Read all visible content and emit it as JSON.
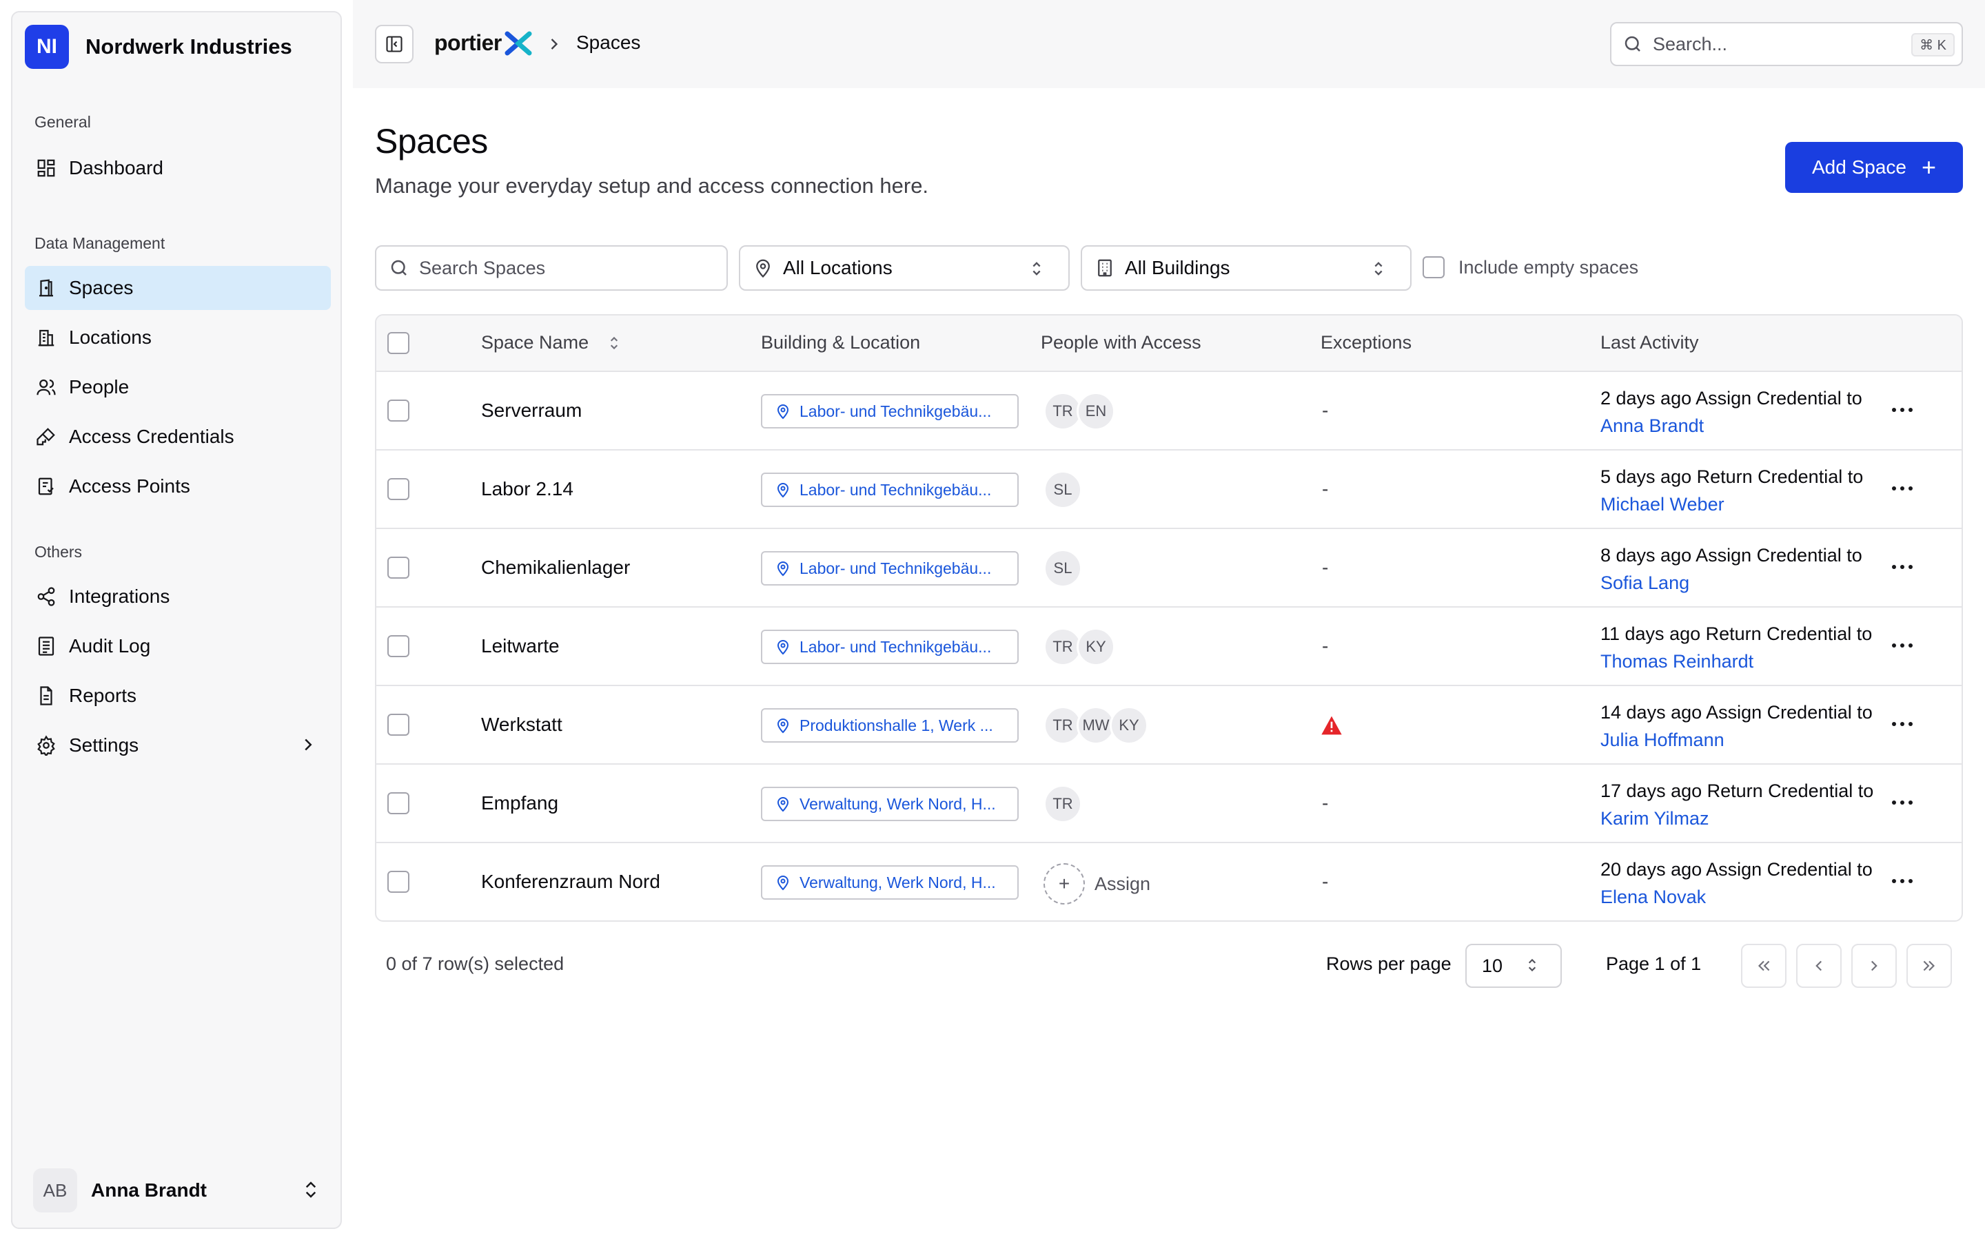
{
  "org": {
    "initials": "NI",
    "name": "Nordwerk Industries",
    "logo_color": "#1f3ee8"
  },
  "sidebar": {
    "sections": [
      {
        "label": "General"
      },
      {
        "label": "Data Management"
      },
      {
        "label": "Others"
      }
    ],
    "items": [
      {
        "label": "Dashboard",
        "icon": "dashboard-icon"
      },
      {
        "label": "Spaces",
        "icon": "door-icon",
        "active": true
      },
      {
        "label": "Locations",
        "icon": "building-icon"
      },
      {
        "label": "People",
        "icon": "people-icon"
      },
      {
        "label": "Access Credentials",
        "icon": "key-icon"
      },
      {
        "label": "Access Points",
        "icon": "access-point-icon"
      },
      {
        "label": "Integrations",
        "icon": "share-icon"
      },
      {
        "label": "Audit Log",
        "icon": "log-icon"
      },
      {
        "label": "Reports",
        "icon": "report-icon"
      },
      {
        "label": "Settings",
        "icon": "gear-icon"
      }
    ],
    "user": {
      "initials": "AB",
      "name": "Anna Brandt"
    }
  },
  "topbar": {
    "brand": "portier",
    "breadcrumb": "Spaces",
    "search_placeholder": "Search...",
    "shortcut": "⌘ K"
  },
  "page": {
    "title": "Spaces",
    "subtitle": "Manage your everyday setup and access connection here.",
    "add_button": "Add Space"
  },
  "filters": {
    "search_placeholder": "Search Spaces",
    "location": "All Locations",
    "building": "All Buildings",
    "include_empty": "Include empty spaces"
  },
  "table": {
    "columns": [
      "Space Name",
      "Building & Location",
      "People with Access",
      "Exceptions",
      "Last Activity"
    ],
    "rows": [
      {
        "name": "Serverraum",
        "location": "Labor- und Technikgebäu...",
        "people": [
          "TR",
          "EN"
        ],
        "exception": "-",
        "activity_prefix": "2 days ago Assign Credential to ",
        "activity_person": "Anna Brandt"
      },
      {
        "name": "Labor 2.14",
        "location": "Labor- und Technikgebäu...",
        "people": [
          "SL"
        ],
        "exception": "-",
        "activity_prefix": "5 days ago Return Credential to ",
        "activity_person": "Michael Weber"
      },
      {
        "name": "Chemikalienlager",
        "location": "Labor- und Technikgebäu...",
        "people": [
          "SL"
        ],
        "exception": "-",
        "activity_prefix": "8 days ago Assign Credential to ",
        "activity_person": "Sofia Lang"
      },
      {
        "name": "Leitwarte",
        "location": "Labor- und Technikgebäu...",
        "people": [
          "TR",
          "KY"
        ],
        "exception": "-",
        "activity_prefix": "11 days ago Return Credential to ",
        "activity_person": "Thomas Reinhardt"
      },
      {
        "name": "Werkstatt",
        "location": "Produktionshalle 1, Werk ...",
        "people": [
          "TR",
          "MW",
          "KY"
        ],
        "exception": "warning",
        "activity_prefix": "14 days ago Assign Credential to ",
        "activity_person": "Julia Hoffmann"
      },
      {
        "name": "Empfang",
        "location": "Verwaltung, Werk Nord, H...",
        "people": [
          "TR"
        ],
        "exception": "-",
        "activity_prefix": "17 days ago Return Credential to ",
        "activity_person": "Karim Yilmaz"
      },
      {
        "name": "Konferenzraum Nord",
        "location": "Verwaltung, Werk Nord, H...",
        "people": [],
        "assign_label": "Assign",
        "exception": "-",
        "activity_prefix": "20 days ago Assign Credential to ",
        "activity_person": "Elena Novak"
      }
    ]
  },
  "footer": {
    "selection": "0 of 7 row(s) selected",
    "rows_per_page_label": "Rows per page",
    "rows_per_page": "10",
    "page_info": "Page 1 of 1"
  },
  "colors": {
    "accent": "#1a3ee0",
    "link": "#1a56db",
    "active_nav": "#d7ebfb",
    "warning": "#e5252a"
  }
}
